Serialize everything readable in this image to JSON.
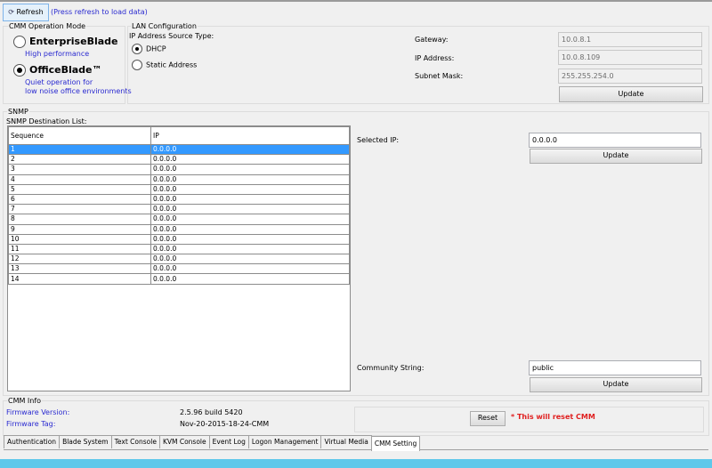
{
  "toolbar": {
    "refresh_label": "Refresh",
    "hint": "(Press refresh to load data)"
  },
  "mode": {
    "title": "CMM Operation Mode",
    "options": [
      {
        "label": "EnterpriseBlade",
        "desc": "High performance",
        "selected": false
      },
      {
        "label": "OfficeBlade™",
        "desc1": "Quiet operation for",
        "desc2": "low noise office environments",
        "selected": true
      }
    ]
  },
  "lan": {
    "title": "LAN Configuration",
    "source_label": "IP Address Source Type:",
    "dhcp": "DHCP",
    "static": "Static Address",
    "gateway_label": "Gateway:",
    "gateway": "10.0.8.1",
    "ip_label": "IP Address:",
    "ip": "10.0.8.109",
    "mask_label": "Subnet Mask:",
    "mask": "255.255.254.0",
    "update": "Update"
  },
  "snmp": {
    "title": "SNMP",
    "list_label": "SNMP Destination List:",
    "columns": [
      "Sequence",
      "IP"
    ],
    "rows": [
      [
        "1",
        "0.0.0.0"
      ],
      [
        "2",
        "0.0.0.0"
      ],
      [
        "3",
        "0.0.0.0"
      ],
      [
        "4",
        "0.0.0.0"
      ],
      [
        "5",
        "0.0.0.0"
      ],
      [
        "6",
        "0.0.0.0"
      ],
      [
        "7",
        "0.0.0.0"
      ],
      [
        "8",
        "0.0.0.0"
      ],
      [
        "9",
        "0.0.0.0"
      ],
      [
        "10",
        "0.0.0.0"
      ],
      [
        "11",
        "0.0.0.0"
      ],
      [
        "12",
        "0.0.0.0"
      ],
      [
        "13",
        "0.0.0.0"
      ],
      [
        "14",
        "0.0.0.0"
      ]
    ],
    "selected_ip_label": "Selected IP:",
    "selected_ip": "0.0.0.0",
    "update": "Update",
    "community_label": "Community String:",
    "community": "public",
    "update2": "Update"
  },
  "info": {
    "title": "CMM Info",
    "fw_version_label": "Firmware Version:",
    "fw_version": "2.5.96  build 5420",
    "fw_tag_label": "Firmware Tag:",
    "fw_tag": "Nov-20-2015-18-24-CMM",
    "reset": "Reset",
    "reset_warning": "* This will reset CMM"
  },
  "tabs": [
    "Authentication",
    "Blade System",
    "Text Console",
    "KVM Console",
    "Event Log",
    "Logon Management",
    "Virtual Media",
    "CMM Setting"
  ],
  "active_tab": "CMM Setting"
}
